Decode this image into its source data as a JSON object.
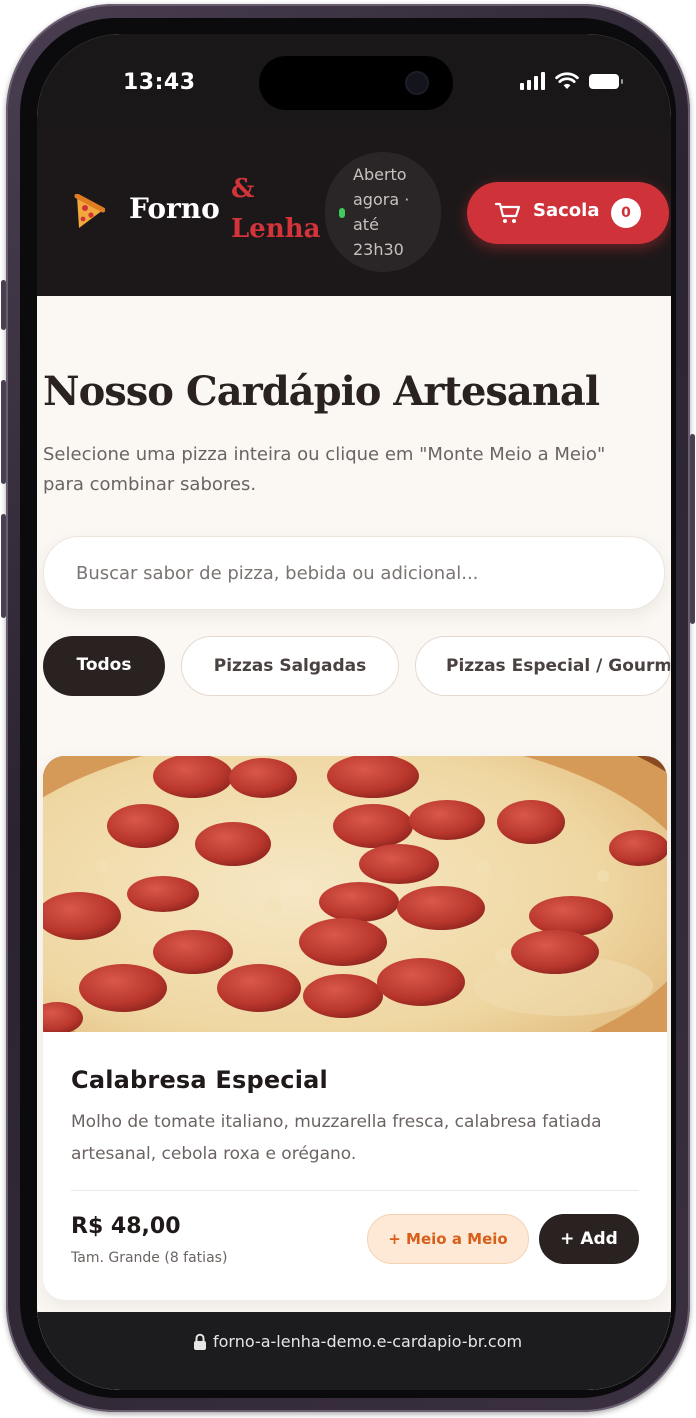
{
  "status_bar": {
    "time": "13:43"
  },
  "header": {
    "brand_part1": "Forno",
    "brand_ampersand": "&",
    "brand_part2": "Lenha",
    "open_status_lines": [
      "Aberto",
      "agora ·",
      "até",
      "23h30"
    ],
    "bag_label": "Sacola",
    "bag_count": "0",
    "accent_color": "#d0323a",
    "logo_icon": "pizza-slice-icon",
    "bag_icon": "shopping-cart-icon"
  },
  "main": {
    "title": "Nosso Cardápio Artesanal",
    "subtitle": "Selecione uma pizza inteira ou clique em \"Monte Meio a Meio\" para combinar sabores.",
    "search": {
      "placeholder": "Buscar sabor de pizza, bebida ou adicional...",
      "value": ""
    },
    "categories": [
      {
        "label": "Todos",
        "active": true
      },
      {
        "label": "Pizzas Salgadas",
        "active": false
      },
      {
        "label": "Pizzas Especial / Gourmet",
        "active": false
      }
    ],
    "products": [
      {
        "name": "Calabresa Especial",
        "description": "Molho de tomate italiano, muzzarella fresca, calabresa fatiada artesanal, cebola roxa e orégano.",
        "price": "R$ 48,00",
        "size_note": "Tam. Grande (8 fatias)",
        "half_label": "+ Meio a Meio",
        "add_label": "+ Add",
        "image": "pepperoni-pizza-photo"
      }
    ]
  },
  "browser": {
    "url": "forno-a-lenha-demo.e-cardapio-br.com",
    "lock_icon": "lock-icon"
  }
}
